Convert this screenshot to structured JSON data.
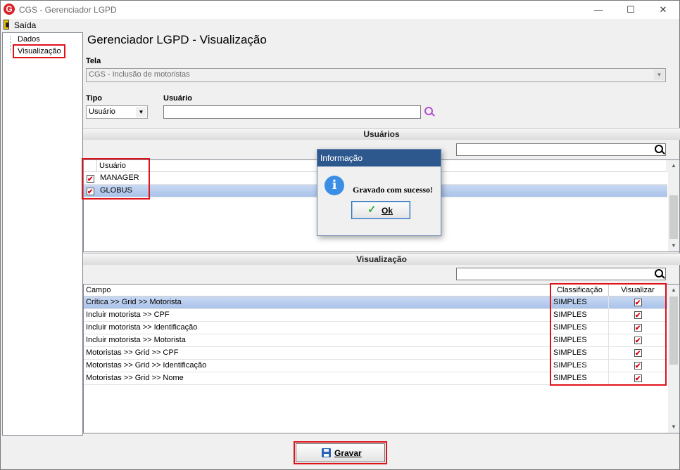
{
  "window": {
    "title": "CGS - Gerenciador LGPD",
    "minimize": "—",
    "maximize": "☐",
    "close": "✕"
  },
  "menu": {
    "exit_label": "Saída"
  },
  "tree": {
    "items": [
      {
        "label": "Dados"
      },
      {
        "label": "Visualização"
      }
    ]
  },
  "heading": "Gerenciador LGPD - Visualização",
  "tela": {
    "label": "Tela",
    "value": "CGS - Inclusão de motoristas"
  },
  "tipo": {
    "label": "Tipo",
    "value": "Usuário"
  },
  "usuario": {
    "label": "Usuário",
    "value": ""
  },
  "users_section": {
    "title": "Usuários",
    "search_value": "",
    "column": "Usuário",
    "rows": [
      {
        "name": "MANAGER",
        "checked": true
      },
      {
        "name": "GLOBUS",
        "checked": true,
        "selected": true
      }
    ]
  },
  "visualizacao_section": {
    "title": "Visualização",
    "search_value": "",
    "columns": {
      "campo": "Campo",
      "classificacao": "Classificação",
      "visualizar": "Visualizar"
    },
    "rows": [
      {
        "campo": "Crítica >> Grid >> Motorista",
        "classificacao": "SIMPLES",
        "visualizar": true,
        "selected": true
      },
      {
        "campo": "Incluir motorista >> CPF",
        "classificacao": "SIMPLES",
        "visualizar": true
      },
      {
        "campo": "Incluir motorista >> Identificação",
        "classificacao": "SIMPLES",
        "visualizar": true
      },
      {
        "campo": "Incluir motorista >> Motorista",
        "classificacao": "SIMPLES",
        "visualizar": true
      },
      {
        "campo": "Motoristas >> Grid >> CPF",
        "classificacao": "SIMPLES",
        "visualizar": true
      },
      {
        "campo": "Motoristas >> Grid >> Identificação",
        "classificacao": "SIMPLES",
        "visualizar": true
      },
      {
        "campo": "Motoristas >> Grid >> Nome",
        "classificacao": "SIMPLES",
        "visualizar": true
      }
    ]
  },
  "dialog": {
    "title": "Informação",
    "message": "Gravado com sucesso!",
    "ok_label": "Ok"
  },
  "gravar_label": "Gravar",
  "colors": {
    "highlight": "#e0121a",
    "dialog_title": "#2d588e",
    "check": "#d40010",
    "selection": "#b4cbee"
  }
}
